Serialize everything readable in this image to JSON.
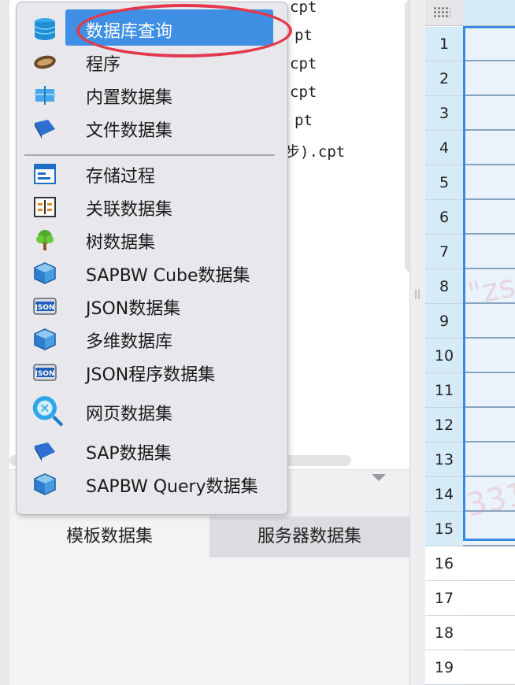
{
  "file_list": [
    {
      "text": "cpt"
    },
    {
      "text": "pt"
    },
    {
      "text": "cpt"
    },
    {
      "text": "cpt"
    },
    {
      "text": "pt"
    },
    {
      "text": "步).cpt"
    }
  ],
  "menu": {
    "items": [
      {
        "label": "数据库查询",
        "icon": "database-icon"
      },
      {
        "label": "程序",
        "icon": "program-bean-icon"
      },
      {
        "label": "内置数据集",
        "icon": "builtin-dataset-icon"
      },
      {
        "label": "文件数据集",
        "icon": "file-dataset-icon"
      },
      {
        "label": "存储过程",
        "icon": "stored-procedure-icon"
      },
      {
        "label": "关联数据集",
        "icon": "related-dataset-icon"
      },
      {
        "label": "树数据集",
        "icon": "tree-icon"
      },
      {
        "label": "SAPBW Cube数据集",
        "icon": "cube-icon"
      },
      {
        "label": "JSON数据集",
        "icon": "json-icon"
      },
      {
        "label": "多维数据库",
        "icon": "cube-icon"
      },
      {
        "label": "JSON程序数据集",
        "icon": "json-icon"
      },
      {
        "label": "网页数据集",
        "icon": "web-search-icon"
      },
      {
        "label": "SAP数据集",
        "icon": "sap-icon"
      },
      {
        "label": "SAPBW Query数据集",
        "icon": "cube-icon"
      }
    ]
  },
  "tabs": [
    {
      "label": "模板数据集"
    },
    {
      "label": "服务器数据集"
    }
  ],
  "grid": {
    "rows": [
      "1",
      "2",
      "3",
      "4",
      "5",
      "6",
      "7",
      "8",
      "9",
      "10",
      "11",
      "12",
      "13",
      "14",
      "15",
      "16",
      "17",
      "18",
      "19"
    ]
  },
  "watermarks": [
    {
      "text": "\"zs"
    },
    {
      "text": "331\""
    }
  ],
  "colors": {
    "highlight": "#3f8fe4",
    "annotation": "#e23a4c",
    "selection_border": "#3a8be0",
    "header_selected": "#d5ecf8"
  }
}
